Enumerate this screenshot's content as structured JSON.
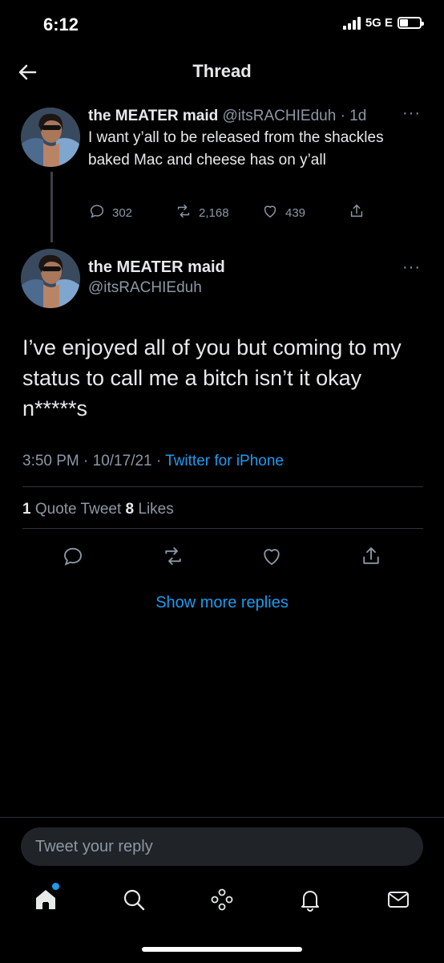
{
  "status_bar": {
    "time": "6:12",
    "network": "5G E"
  },
  "header": {
    "title": "Thread"
  },
  "parent_tweet": {
    "name": "the MEATER maid",
    "handle": "@itsRACHIEduh",
    "age": "· 1d",
    "text": "I want y’all to be released from the shackles baked Mac and cheese has on y’all",
    "replies": "302",
    "retweets": "2,168",
    "likes": "439"
  },
  "focus_tweet": {
    "name": "the MEATER maid",
    "handle": "@itsRACHIEduh",
    "text": "I’ve enjoyed all of you but coming to my status to call me a bitch isn’t it okay n*****s",
    "time": "3:50 PM · 10/17/21 · ",
    "source": "Twitter for iPhone",
    "quote_count": "1",
    "quote_label": " Quote Tweet  ",
    "like_count": "8",
    "like_label": " Likes"
  },
  "show_more": "Show more replies",
  "reply": {
    "placeholder": "Tweet your reply"
  },
  "colors": {
    "accent": "#1d9bf0",
    "muted": "#8b98a5",
    "background": "#000000"
  },
  "tabs": [
    "home-icon",
    "search-icon",
    "spaces-icon",
    "notifications-icon",
    "messages-icon"
  ]
}
